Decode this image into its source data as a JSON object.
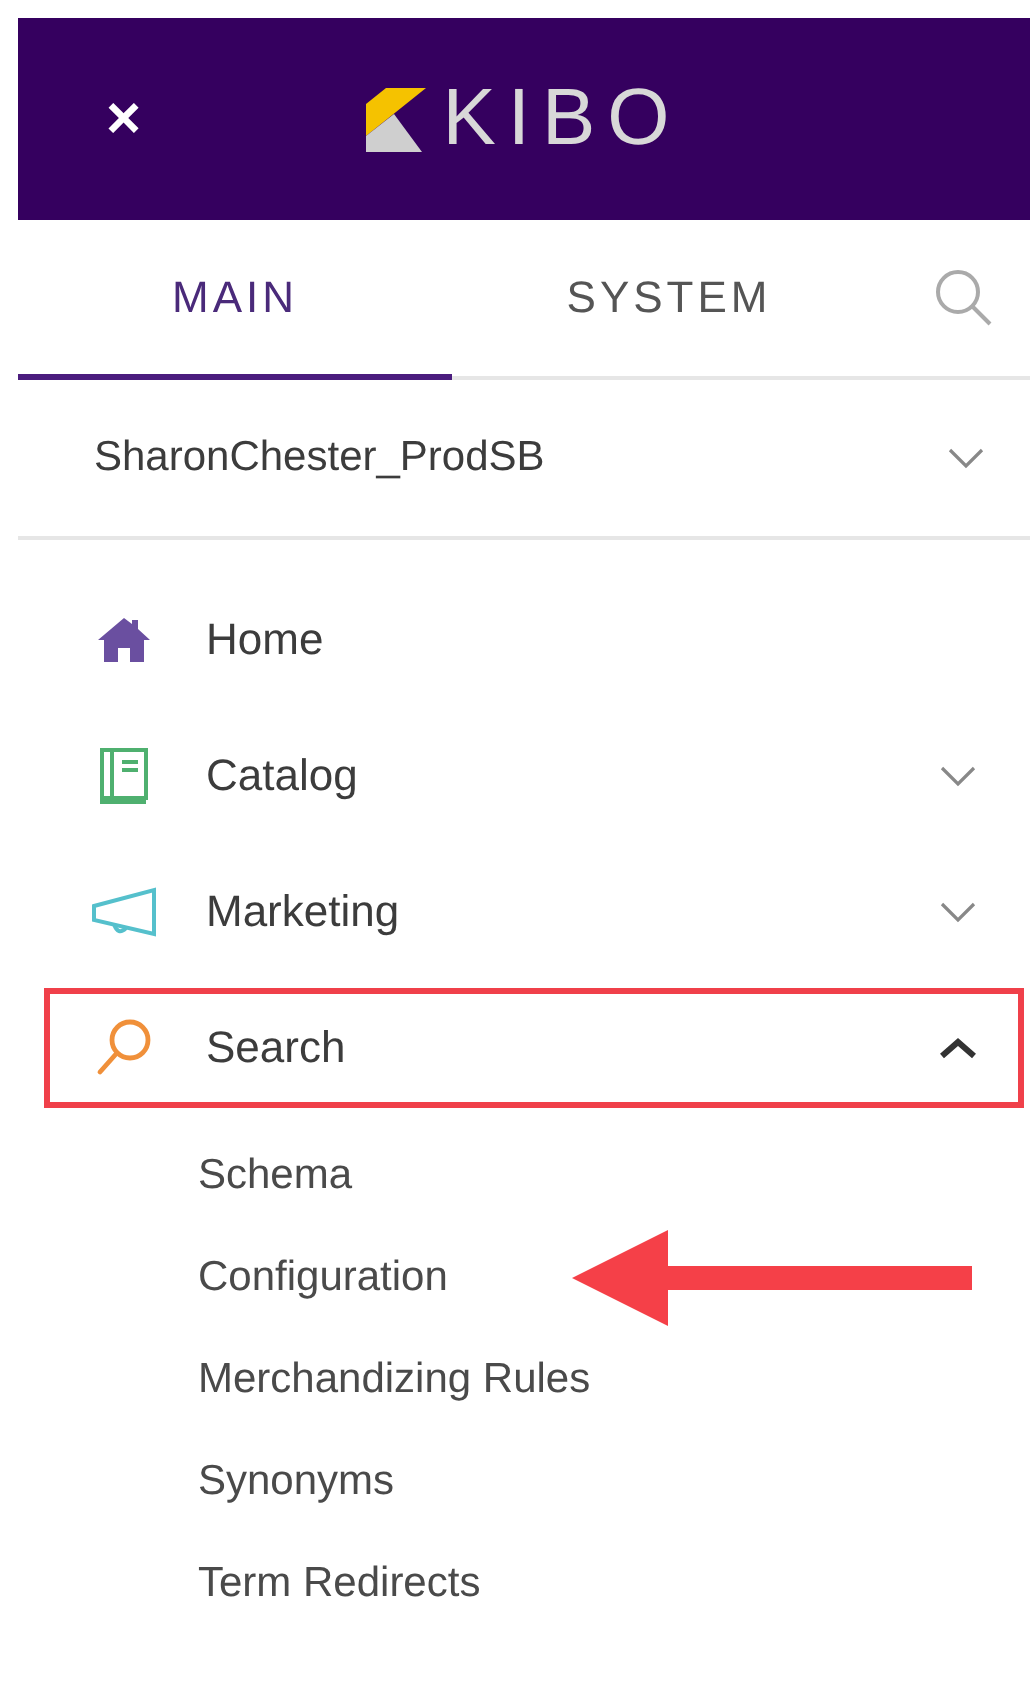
{
  "header": {
    "close": "×",
    "logo": "KIBO"
  },
  "tabs": [
    {
      "label": "MAIN",
      "selected": true
    },
    {
      "label": "SYSTEM",
      "selected": false
    }
  ],
  "tenant": {
    "value": "SharonChester_ProdSB"
  },
  "nav": [
    {
      "label": "Home",
      "kind": "link",
      "highlighted": false
    },
    {
      "label": "Catalog",
      "kind": "group",
      "expanded": false,
      "highlighted": false
    },
    {
      "label": "Marketing",
      "kind": "group",
      "expanded": false,
      "highlighted": false
    },
    {
      "label": "Search",
      "kind": "group",
      "expanded": true,
      "highlighted": true,
      "children": [
        {
          "label": "Schema",
          "pointed": false
        },
        {
          "label": "Configuration",
          "pointed": true
        },
        {
          "label": "Merchandizing Rules",
          "pointed": false
        },
        {
          "label": "Synonyms",
          "pointed": false
        },
        {
          "label": "Term Redirects",
          "pointed": false
        }
      ]
    }
  ]
}
